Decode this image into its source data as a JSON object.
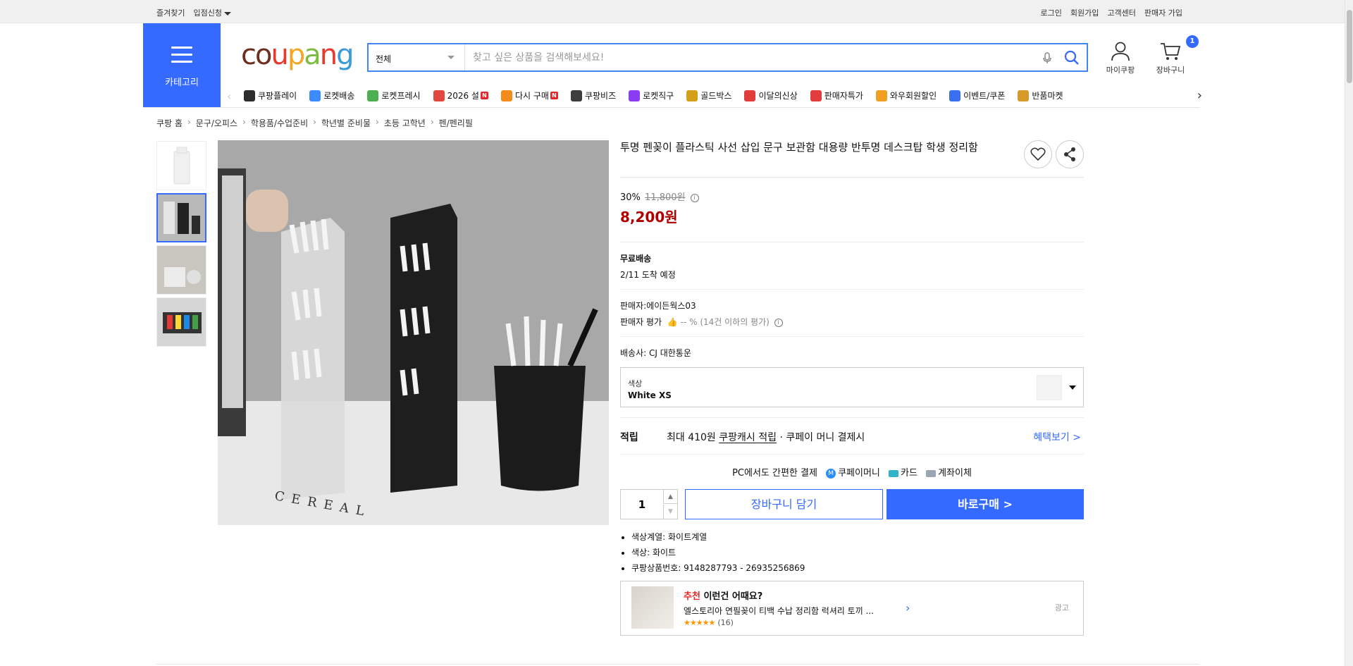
{
  "topbar": {
    "favorites": "즐겨찾기",
    "entry": "입점신청",
    "login": "로그인",
    "signup": "회원가입",
    "support": "고객센터",
    "seller_signup": "판매자 가입"
  },
  "header": {
    "category_label": "카테고리",
    "search_category": "전체",
    "search_placeholder": "찾고 싶은 상품을 검색해보세요!",
    "mycoupang_label": "마이쿠팡",
    "cart_label": "장바구니",
    "cart_count": "1"
  },
  "gnb": [
    {
      "label": "쿠팡플레이",
      "color": "#2d2d2d",
      "new": false
    },
    {
      "label": "로켓배송",
      "color": "#3a8cff",
      "new": false
    },
    {
      "label": "로켓프레시",
      "color": "#4caf50",
      "new": false
    },
    {
      "label": "2026 설",
      "color": "#e0483e",
      "new": true
    },
    {
      "label": "다시 구매",
      "color": "#f28a1c",
      "new": true
    },
    {
      "label": "쿠팡비즈",
      "color": "#3d3d3d",
      "new": false
    },
    {
      "label": "로켓직구",
      "color": "#8a3cf0",
      "new": false
    },
    {
      "label": "골드박스",
      "color": "#d4a017",
      "new": false
    },
    {
      "label": "이달의신상",
      "color": "#e23c3c",
      "new": false
    },
    {
      "label": "판매자특가",
      "color": "#e23c3c",
      "new": false
    },
    {
      "label": "와우회원할인",
      "color": "#f0a020",
      "new": false
    },
    {
      "label": "이벤트/쿠폰",
      "color": "#3a6ff0",
      "new": false
    },
    {
      "label": "반품마켓",
      "color": "#d49a2a",
      "new": false
    }
  ],
  "breadcrumb": [
    "쿠팡 홈",
    "문구/오피스",
    "학용품/수업준비",
    "학년별 준비물",
    "초등 고학년",
    "펜/펜리필"
  ],
  "product": {
    "title": "투명 펜꽂이 플라스틱 사선 삽입 문구 보관함 대용량 반투명 데스크탑 학생 정리함",
    "discount": "30%",
    "original_price": "11,800원",
    "sale_price": "8,200원",
    "shipping_title": "무료배송",
    "arrival": "2/11 도착 예정",
    "seller": "판매자:에이든웍스03",
    "seller_rating_label": "판매자 평가",
    "seller_rating_value": "-- % (14건 이하의 평가)",
    "courier": "배송사:  CJ 대한통운",
    "option_key": "색상",
    "option_value": "White XS",
    "reward_label": "적립",
    "reward_prefix": "최대 410원 ",
    "reward_link": "쿠팡캐시 적립",
    "reward_suffix": " · 쿠페이 머니 결제시",
    "reward_more": "혜택보기 >",
    "pay_title": "PC에서도 간편한 결제",
    "pay_coupay": "쿠페이머니",
    "pay_card": "카드",
    "pay_bank": "계좌이체",
    "quantity": "1",
    "cart_button": "장바구니 담기",
    "buy_button": "바로구매 >",
    "attributes": [
      "색상계열: 화이트계열",
      "색상: 화이트",
      "쿠팡상품번호: 9148287793 - 26935256869"
    ]
  },
  "recommend": {
    "heading_red": "추천",
    "heading_rest": " 이런건 어때요?",
    "name": "엘스토리아 연필꽂이 티백 수납 정리함 럭셔리 토끼 ...",
    "stars": "★★★★★",
    "count": "(16)",
    "ad_label": "광고"
  }
}
